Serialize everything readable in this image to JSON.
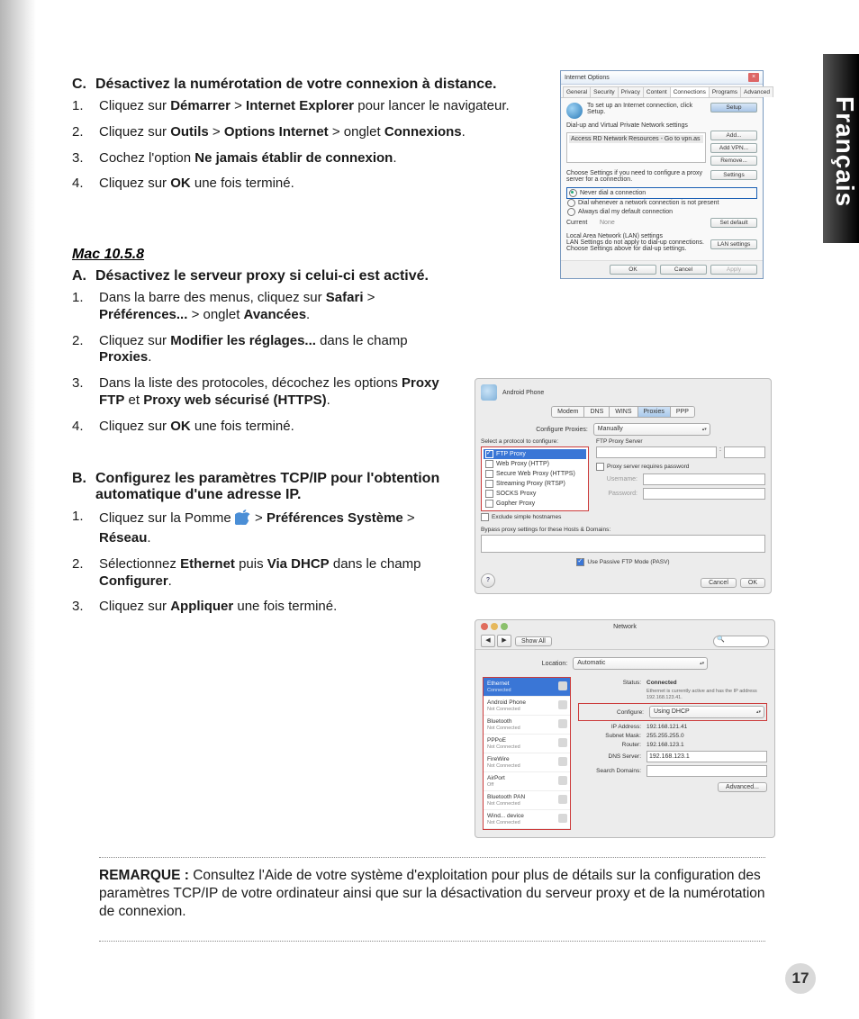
{
  "side_tab": "Français",
  "page_number": "17",
  "sectionC": {
    "letter": "C.",
    "title_a": "Désactivez la numérotation de votre connexion à distance.",
    "steps": [
      {
        "n": "1.",
        "pre": "Cliquez sur ",
        "b1": "Démarrer",
        "mid": " > ",
        "b2": "Internet Explorer",
        "post": " pour lancer le navigateur."
      },
      {
        "n": "2.",
        "pre": "Cliquez sur ",
        "b1": "Outils",
        "mid": " > ",
        "b2": "Options Internet",
        "mid2": " > onglet ",
        "b3": "Connexions",
        "post": "."
      },
      {
        "n": "3.",
        "pre": "Cochez l'option ",
        "b1": "Ne jamais établir de connexion",
        "post": "."
      },
      {
        "n": "4.",
        "pre": "Cliquez sur ",
        "b1": "OK",
        "post": " une fois terminé."
      }
    ]
  },
  "mac_header": "Mac 10.5.8",
  "sectionA": {
    "letter": "A.",
    "title_a": "Désactivez le serveur proxy si celui-ci est activé.",
    "steps": [
      {
        "n": "1.",
        "pre": "Dans la barre des menus, cliquez sur ",
        "b1": "Safari",
        "mid": " > ",
        "b2": "Préférences...",
        "mid2": " > onglet    ",
        "b3": "Avancées",
        "post": "."
      },
      {
        "n": "2.",
        "pre": "Cliquez sur ",
        "b1": "Modifier les réglages...",
        "mid": " dans le champ ",
        "b2": "Proxies",
        "post": "."
      },
      {
        "n": "3.",
        "pre": "Dans la liste des protocoles, décochez les options ",
        "b1": "Proxy FTP",
        "mid": " et ",
        "b2": "Proxy web sécurisé (HTTPS)",
        "post": "."
      },
      {
        "n": "4.",
        "pre": "Cliquez sur ",
        "b1": "OK",
        "post": " une fois terminé."
      }
    ]
  },
  "sectionB": {
    "letter": "B.",
    "title_a": "Configurez les paramètres TCP/IP pour l'obtention automatique d'une adresse IP.",
    "steps": [
      {
        "n": "1.",
        "pre": "Cliquez sur la Pomme  ",
        "icon": "",
        "mid": "  > ",
        "b1": "Préférences Système",
        "mid2": " > ",
        "b2": "Réseau",
        "post": "."
      },
      {
        "n": "2.",
        "pre": "Sélectionnez ",
        "b1": "Ethernet",
        "mid": " puis ",
        "b2": "Via DHCP",
        "mid2": " dans le champ ",
        "b3": "Configurer",
        "post": "."
      },
      {
        "n": "3.",
        "pre": "Cliquez sur ",
        "b1": "Appliquer",
        "post": " une fois terminé."
      }
    ]
  },
  "note": {
    "label": "REMARQUE : ",
    "text": " Consultez l'Aide de votre système d'exploitation pour plus de détails sur la configuration des paramètres TCP/IP de votre ordinateur ainsi que sur la désactivation du serveur proxy et de la numérotation de connexion."
  },
  "io": {
    "title": "Internet Options",
    "tabs": [
      "General",
      "Security",
      "Privacy",
      "Content",
      "Connections",
      "Programs",
      "Advanced"
    ],
    "setup_text": "To set up an Internet connection, click Setup.",
    "setup_btn": "Setup",
    "dial_hdr": "Dial-up and Virtual Private Network settings",
    "list_item": "Access RD Network Resources - Go to vpn.as",
    "add_btn": "Add...",
    "addvpn_btn": "Add VPN...",
    "remove_btn": "Remove...",
    "choose_text": "Choose Settings if you need to configure a proxy server for a connection.",
    "settings_btn": "Settings",
    "r1": "Never dial a connection",
    "r2": "Dial whenever a network connection is not present",
    "r3": "Always dial my default connection",
    "curr_lbl": "Current",
    "curr_val": "None",
    "setdef_btn": "Set default",
    "lan_hdr": "Local Area Network (LAN) settings",
    "lan_text": "LAN Settings do not apply to dial-up connections. Choose Settings above for dial-up settings.",
    "lan_btn": "LAN settings",
    "ok": "OK",
    "cancel": "Cancel",
    "apply": "Apply"
  },
  "mp": {
    "device": "Android Phone",
    "tabs": [
      "Modem",
      "DNS",
      "WINS",
      "Proxies",
      "PPP"
    ],
    "cfg_lbl": "Configure Proxies:",
    "cfg_val": "Manually",
    "proto_hdr": "Select a protocol to configure:",
    "protos": [
      "FTP Proxy",
      "Web Proxy (HTTP)",
      "Secure Web Proxy (HTTPS)",
      "Streaming Proxy (RTSP)",
      "SOCKS Proxy",
      "Gopher Proxy"
    ],
    "exclude": "Exclude simple hostnames",
    "ftp_hdr": "FTP Proxy Server",
    "req_pw": "Proxy server requires password",
    "user_lbl": "Username:",
    "pass_lbl": "Password:",
    "bypass": "Bypass proxy settings for these Hosts & Domains:",
    "pasv": "Use Passive FTP Mode (PASV)",
    "help": "?",
    "cancel": "Cancel",
    "ok": "OK"
  },
  "nw": {
    "title": "Network",
    "show_all": "Show All",
    "loc_lbl": "Location:",
    "loc_val": "Automatic",
    "items": [
      {
        "nm": "Ethernet",
        "st": "Connected"
      },
      {
        "nm": "Android Phone",
        "st": "Not Connected"
      },
      {
        "nm": "Bluetooth",
        "st": "Not Connected"
      },
      {
        "nm": "PPPoE",
        "st": "Not Connected"
      },
      {
        "nm": "FireWire",
        "st": "Not Connected"
      },
      {
        "nm": "AirPort",
        "st": "Off"
      },
      {
        "nm": "Bluetooth PAN",
        "st": "Not Connected"
      },
      {
        "nm": "Wind... device",
        "st": "Not Connected"
      }
    ],
    "status_lbl": "Status:",
    "status_val": "Connected",
    "status_sub": "Ethernet is currently active and has the IP address 192.168.123.41.",
    "cfg_lbl": "Configure:",
    "cfg_val": "Using DHCP",
    "ip_lbl": "IP Address:",
    "ip_val": "192.168.121.41",
    "mask_lbl": "Subnet Mask:",
    "mask_val": "255.255.255.0",
    "router_lbl": "Router:",
    "router_val": "192.168.123.1",
    "dns_lbl": "DNS Server:",
    "dns_val": "192.168.123.1",
    "search_lbl": "Search Domains:",
    "adv_btn": "Advanced..."
  }
}
